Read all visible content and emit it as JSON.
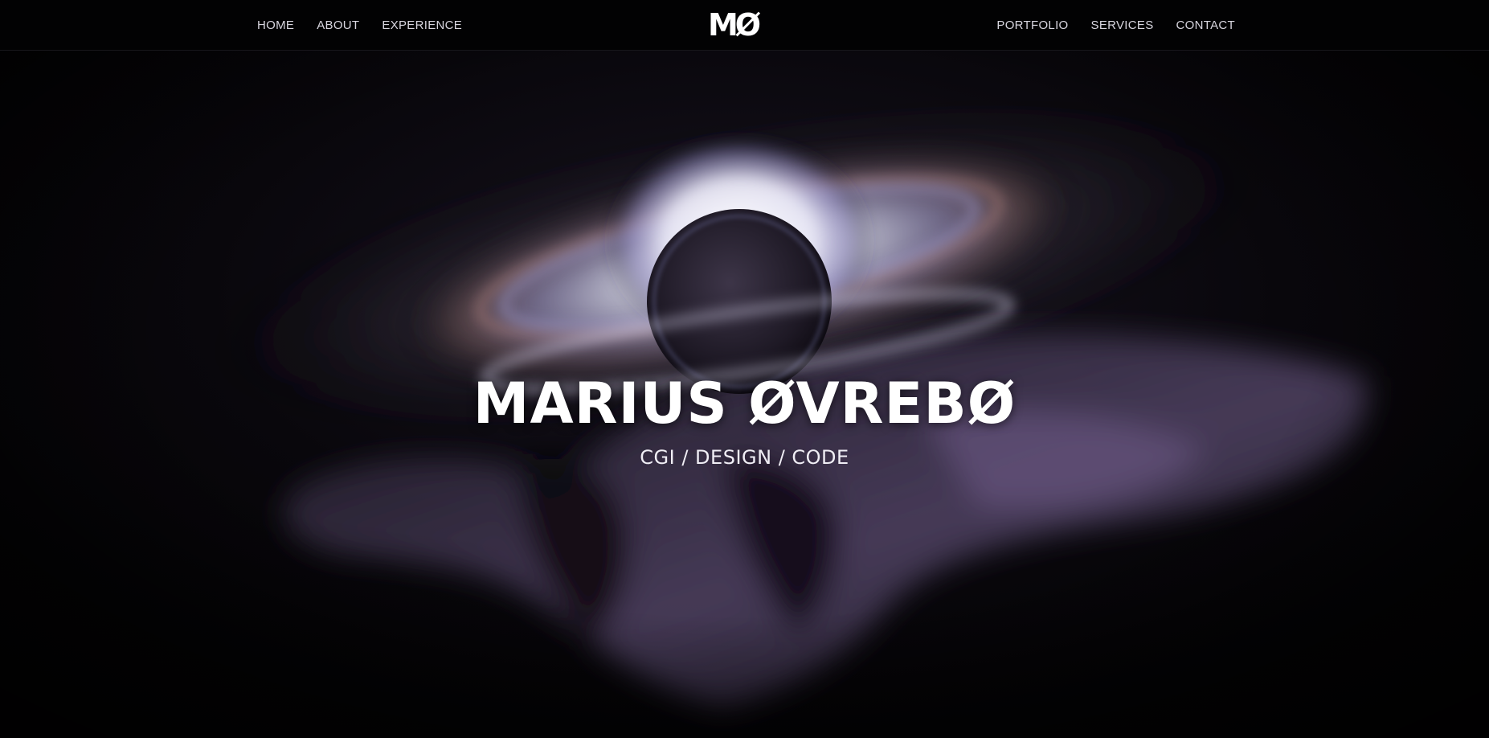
{
  "nav": {
    "left_links": [
      "HOME",
      "ABOUT",
      "EXPERIENCE"
    ],
    "right_links": [
      "PORTFOLIO",
      "SERVICES",
      "CONTACT"
    ],
    "logo_text": "MØ"
  },
  "hero": {
    "title": "MARIUS ØVREBØ",
    "subtitle": "CGI / DESIGN / CODE",
    "background_image": "black-hole-hand"
  },
  "colors": {
    "background": "#050407",
    "nav_background": "#020203",
    "text": "#ffffff",
    "accent_glow": "#cfd3f5",
    "accent_purple": "#6a5687"
  }
}
